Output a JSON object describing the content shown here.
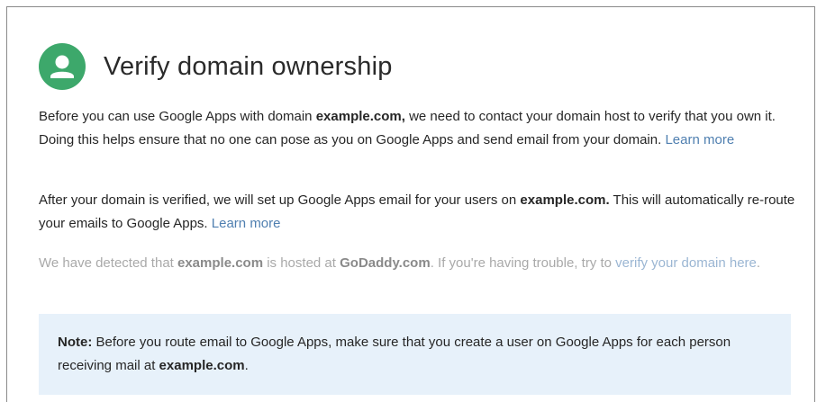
{
  "header": {
    "title": "Verify domain ownership",
    "icon": "user-avatar-icon",
    "icon_color": "#3da86b"
  },
  "paragraph1": {
    "text_before": "Before you can use Google Apps with domain ",
    "domain": "example.com,",
    "text_after": " we need to contact your domain host to verify that you own it. Doing this helps ensure that no one can pose as you on Google Apps and send email from your domain.",
    "link": "Learn more"
  },
  "paragraph2": {
    "text_before": "After your domain is verified, we will set up Google Apps email for your users on ",
    "domain": "example.com.",
    "text_after": " This will automatically re-route your emails to Google Apps.",
    "link": "Learn more"
  },
  "paragraph3": {
    "text_before": "We have detected that ",
    "domain": "example.com",
    "text_middle": " is hosted at ",
    "host": "GoDaddy.com",
    "text_after": ". If you're having trouble, try to ",
    "link": "verify your domain here",
    "text_end": "."
  },
  "note": {
    "label": "Note:",
    "text_before": " Before you route email to Google Apps, make sure that you create a user on Google Apps for each person receiving mail at ",
    "domain": "example.com",
    "text_end": ".",
    "background": "#e7f1fa"
  },
  "colors": {
    "link": "#4f7fb0",
    "link_muted": "#9bb6d3",
    "text_muted": "#a9a9a9"
  }
}
